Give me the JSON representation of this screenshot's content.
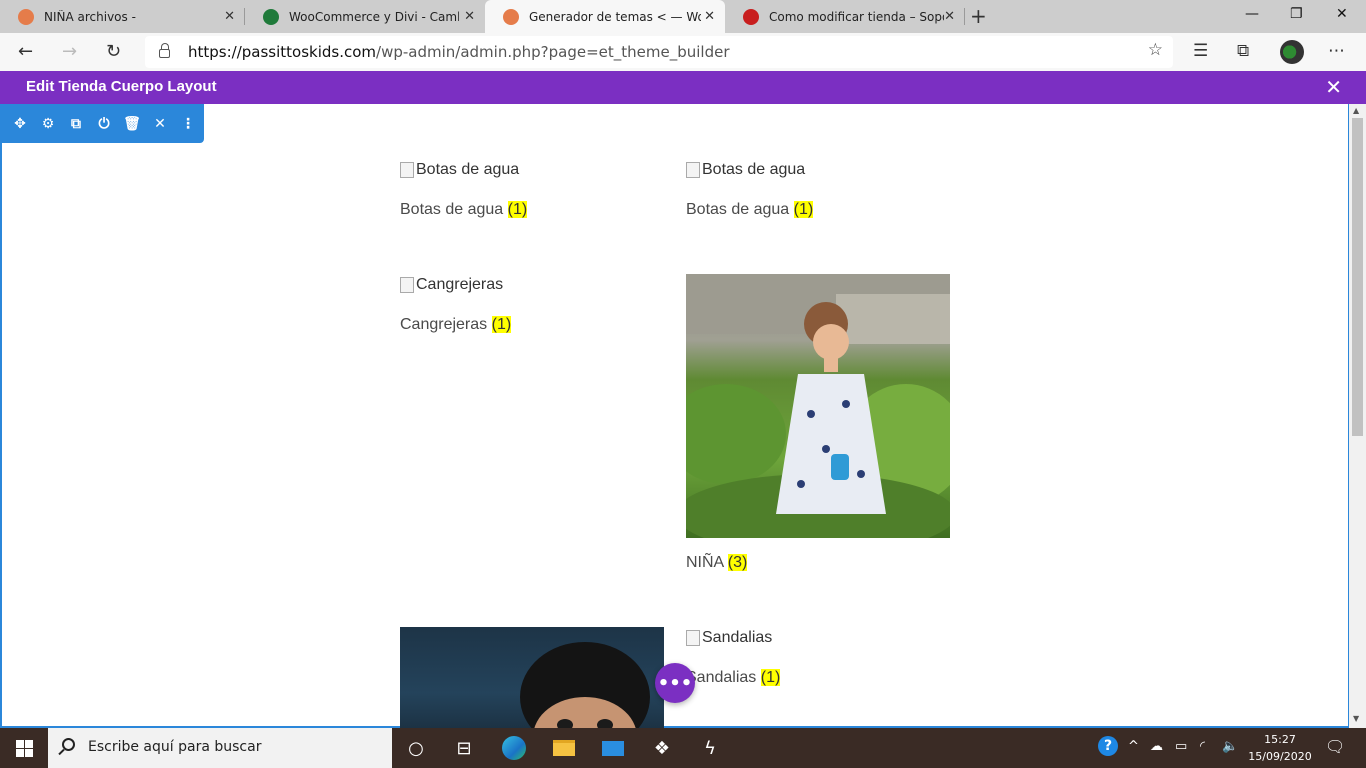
{
  "browser": {
    "tabs": [
      {
        "title": "NIÑA archivos -",
        "favicon_color": "#e57c4a",
        "active": false
      },
      {
        "title": "WooCommerce y Divi - Cambiar",
        "favicon_color": "#1f7a3a",
        "active": false
      },
      {
        "title": "Generador de temas < — WordP",
        "favicon_color": "#e57c4a",
        "active": true
      },
      {
        "title": "Como modificar tienda – Soporte",
        "favicon_color": "#c81e1e",
        "active": false
      }
    ],
    "url_host": "https://passittoskids.com",
    "url_path": "/wp-admin/admin.php?page=et_theme_builder"
  },
  "divi": {
    "title": "Edit Tienda Cuerpo Layout",
    "accent": "#7b2fc2",
    "toolbar_color": "#2b87da",
    "toolbar_tools": [
      "move-icon",
      "settings-icon",
      "duplicate-icon",
      "power-icon",
      "trash-icon",
      "close-icon",
      "more-icon"
    ]
  },
  "categories": [
    {
      "alt": "Botas de agua",
      "name": "Botas de agua",
      "count": "(1)"
    },
    {
      "alt": "Botas de agua",
      "name": "Botas de agua",
      "count": "(1)"
    },
    {
      "alt": "Cangrejeras",
      "name": "Cangrejeras",
      "count": "(1)"
    },
    {
      "alt": "",
      "name": "NIÑA",
      "count": "(3)"
    },
    {
      "alt": "",
      "name": "",
      "count": ""
    },
    {
      "alt": "Sandalias",
      "name": "Sandalias",
      "count": "(1)"
    }
  ],
  "taskbar": {
    "search_placeholder": "Escribe aquí para buscar",
    "time": "15:27",
    "date": "15/09/2020"
  }
}
